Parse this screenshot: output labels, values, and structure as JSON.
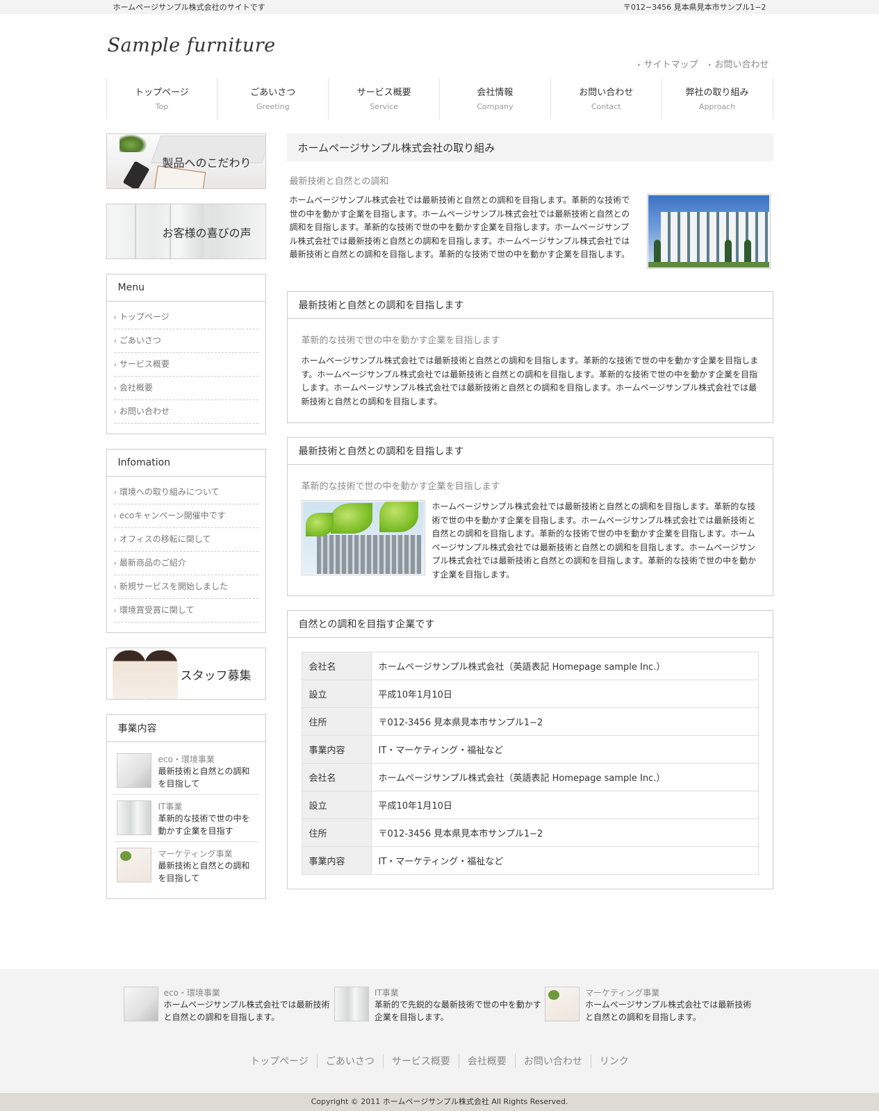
{
  "topbar": {
    "left": "ホームページサンプル株式会社のサイトです",
    "right": "〒012−3456 見本県見本市サンプル1−2"
  },
  "header": {
    "logo": "Sample furniture",
    "util": [
      "サイトマップ",
      "お問い合わせ"
    ]
  },
  "gnav": [
    {
      "jp": "トップページ",
      "en": "Top"
    },
    {
      "jp": "ごあいさつ",
      "en": "Greeting"
    },
    {
      "jp": "サービス概要",
      "en": "Service"
    },
    {
      "jp": "会社情報",
      "en": "Company"
    },
    {
      "jp": "お問い合わせ",
      "en": "Contact"
    },
    {
      "jp": "弊社の取り組み",
      "en": "Approach"
    }
  ],
  "side": {
    "banner1": "製品へのこだわり",
    "banner2": "お客様の喜びの声",
    "menu_title": "Menu",
    "menu": [
      "トップページ",
      "ごあいさつ",
      "サービス概要",
      "会社概要",
      "お問い合わせ"
    ],
    "info_title": "Infomation",
    "info": [
      "環境への取り組みについて",
      "ecoキャンペーン開催中です",
      "オフィスの移転に関して",
      "最新商品のご紹介",
      "新規サービスを開始しました",
      "環境賞受賞に関して"
    ],
    "banner3": "スタッフ募集",
    "biz_title": "事業内容",
    "biz": [
      {
        "cat": "eco・環境事業",
        "desc": "最新技術と自然との調和を目指して"
      },
      {
        "cat": "IT事業",
        "desc": "革新的な技術で世の中を動かす企業を目指す"
      },
      {
        "cat": "マーケティング事業",
        "desc": "最新技術と自然との調和を目指して"
      }
    ]
  },
  "main": {
    "title": "ホームページサンプル株式会社の取り組み",
    "sub": "最新技術と自然との調和",
    "intro": "ホームページサンプル株式会社では最新技術と自然との調和を目指します。革新的な技術で世の中を動かす企業を目指します。ホームページサンプル株式会社では最新技術と自然との調和を目指します。革新的な技術で世の中を動かす企業を目指します。ホームページサンプル株式会社では最新技術と自然との調和を目指します。ホームページサンプル株式会社では最新技術と自然との調和を目指します。革新的な技術で世の中を動かす企業を目指します。",
    "box1": {
      "title": "最新技術と自然との調和を目指します",
      "sub": "革新的な技術で世の中を動かす企業を目指します",
      "text": "ホームページサンプル株式会社では最新技術と自然との調和を目指します。革新的な技術で世の中を動かす企業を目指します。ホームページサンプル株式会社では最新技術と自然との調和を目指します。革新的な技術で世の中を動かす企業を目指します。ホームページサンプル株式会社では最新技術と自然との調和を目指します。ホームページサンプル株式会社では最新技術と自然との調和を目指します。"
    },
    "box2": {
      "title": "最新技術と自然との調和を目指します",
      "sub": "革新的な技術で世の中を動かす企業を目指します",
      "text": "ホームページサンプル株式会社では最新技術と自然との調和を目指します。革新的な技術で世の中を動かす企業を目指します。ホームページサンプル株式会社では最新技術と自然との調和を目指します。革新的な技術で世の中を動かす企業を目指します。ホームページサンプル株式会社では最新技術と自然との調和を目指します。ホームページサンプル株式会社では最新技術と自然との調和を目指します。革新的な技術で世の中を動かす企業を目指します。"
    },
    "box3": {
      "title": "自然との調和を目指す企業です",
      "rows": [
        {
          "k": "会社名",
          "v": "ホームページサンプル株式会社（英語表記 Homepage sample Inc.）"
        },
        {
          "k": "設立",
          "v": "平成10年1月10日"
        },
        {
          "k": "住所",
          "v": "〒012-3456 見本県見本市サンプル1−2"
        },
        {
          "k": "事業内容",
          "v": "IT・マーケティング・福祉など"
        },
        {
          "k": "会社名",
          "v": "ホームページサンプル株式会社（英語表記 Homepage sample Inc.）"
        },
        {
          "k": "設立",
          "v": "平成10年1月10日"
        },
        {
          "k": "住所",
          "v": "〒012-3456 見本県見本市サンプル1−2"
        },
        {
          "k": "事業内容",
          "v": "IT・マーケティング・福祉など"
        }
      ]
    }
  },
  "footer": {
    "items": [
      {
        "cat": "eco・環境事業",
        "desc": "ホームページサンプル株式会社では最新技術と自然との調和を目指します。"
      },
      {
        "cat": "IT事業",
        "desc": "革新的で先鋭的な最新技術で世の中を動かす企業を目指します。"
      },
      {
        "cat": "マーケティング事業",
        "desc": "ホームページサンプル株式会社では最新技術と自然との調和を目指します。"
      }
    ],
    "nav": [
      "トップページ",
      "ごあいさつ",
      "サービス概要",
      "会社概要",
      "お問い合わせ",
      "リンク"
    ],
    "copyright": "Copyright © 2011 ホームページサンプル株式会社 All Rights Reserved."
  }
}
